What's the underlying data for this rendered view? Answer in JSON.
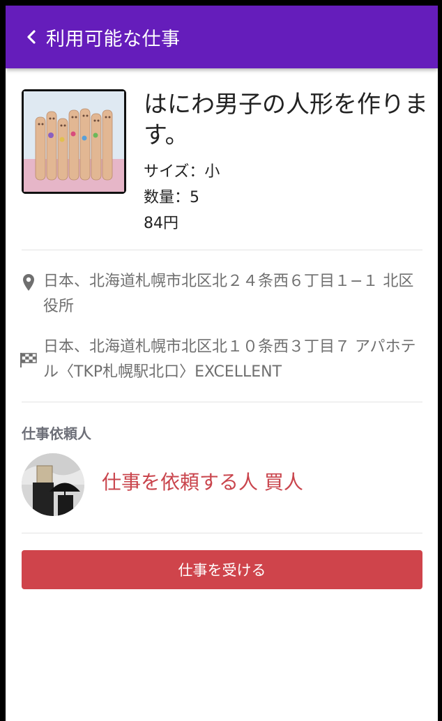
{
  "header": {
    "title": "利用可能な仕事"
  },
  "product": {
    "title": "はにわ男子の人形を作ります。",
    "size": "サイズ：小",
    "quantity": "数量：5",
    "price": "84円"
  },
  "locations": {
    "pickup": "日本、北海道札幌市北区北２４条西６丁目１−１ 北区役所",
    "destination": "日本、北海道札幌市北区北１０条西３丁目７ アパホテル〈TKP札幌駅北口〉EXCELLENT"
  },
  "requester": {
    "section_label": "仕事依頼人",
    "name": "仕事を依頼する人 買人"
  },
  "actions": {
    "accept_label": "仕事を受ける"
  },
  "colors": {
    "header": "#651dbb",
    "accent": "#cf444b",
    "requester_name": "#c9444c"
  },
  "icons": {
    "back": "chevron-left-icon",
    "pickup": "map-pin-icon",
    "destination": "checkered-flag-icon"
  }
}
